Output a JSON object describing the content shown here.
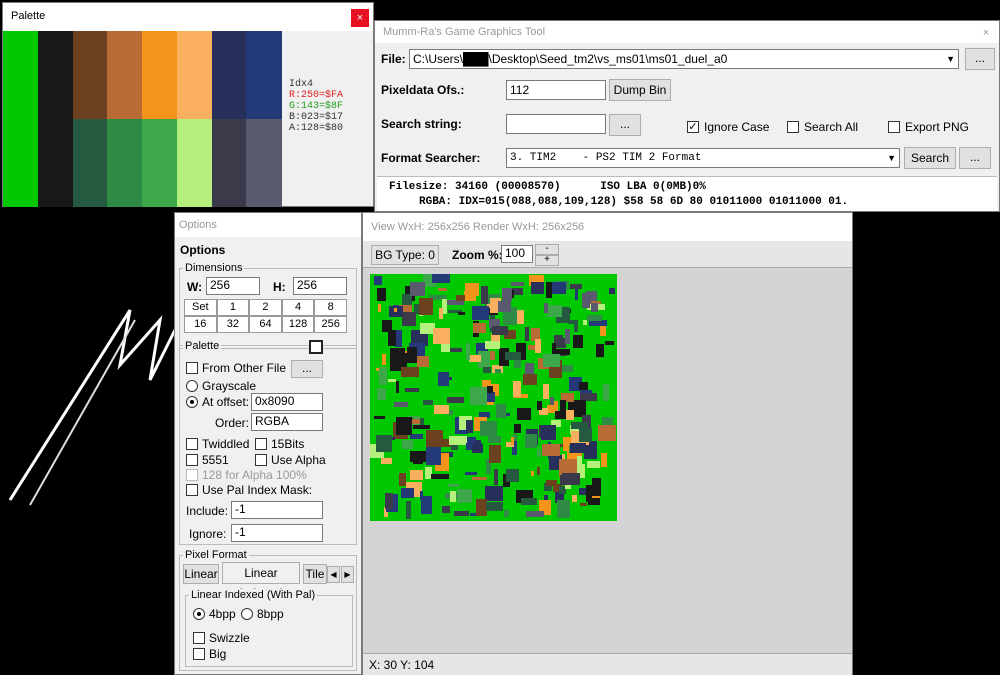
{
  "palette": {
    "title": "Palette",
    "close_label": "×",
    "info": {
      "idx": "Idx4",
      "r": "R:250=$FA",
      "g": "G:143=$8F",
      "b": "B:023=$17",
      "a": "A:128=$80"
    },
    "colors": {
      "row1": [
        "#00c800",
        "#181818",
        "#6b4120",
        "#b86b34",
        "#f5941d",
        "#fbb060",
        "#27305a",
        "#243a78"
      ],
      "row2": [
        "#00c800",
        "#181818",
        "#265a40",
        "#2f8a46",
        "#3da84a",
        "#b6f07c",
        "#3a3a4a",
        "#5a5a6e"
      ]
    }
  },
  "main": {
    "title": "Mumm-Ra's Game Graphics Tool",
    "close_label": "×",
    "file_label": "File:",
    "file_path": "C:\\Users\\███\\Desktop\\Seed_tm2\\vs_ms01\\ms01_duel_a0",
    "browse_label": "...",
    "pixeldata_label": "Pixeldata Ofs.:",
    "pixeldata_value": "112",
    "dump_bin_label": "Dump Bin",
    "search_string_label": "Search string:",
    "search_string_value": "",
    "search_browse_label": "...",
    "ignore_case_label": "Ignore Case",
    "search_all_label": "Search All",
    "export_png_label": "Export PNG",
    "format_searcher_label": "Format Searcher:",
    "format_value": "3. TIM2    - PS2 TIM 2 Format",
    "search_button_label": "Search",
    "format_browse_label": "...",
    "filesize_line": "Filesize: 34160 (00008570)      ISO LBA 0(0MB)0%",
    "rgba_line": "RGBA: IDX=015(088,088,109,128) $58 58 6D 80 01011000 01011000 01."
  },
  "options": {
    "title": "Options",
    "heading": "Options",
    "dimensions_label": "Dimensions",
    "w_label": "W:",
    "w_value": "256",
    "h_label": "H:",
    "h_value": "256",
    "size_row1": [
      "Set",
      "1",
      "2",
      "4",
      "8"
    ],
    "size_row2": [
      "16",
      "32",
      "64",
      "128",
      "256"
    ],
    "palette_group_label": "Palette",
    "from_other_file_label": "From Other File",
    "from_other_browse": "...",
    "grayscale_label": "Grayscale",
    "at_offset_label": "At offset:",
    "at_offset_value": "0x8090",
    "order_label": "Order:",
    "order_value": "RGBA",
    "twiddled_label": "Twiddled",
    "bits15_label": "15Bits",
    "c5551_label": "5551",
    "use_alpha_label": "Use Alpha",
    "alpha128_label": "128 for Alpha 100%",
    "use_pal_mask_label": "Use Pal Index Mask:",
    "include_label": "Include:",
    "include_value": "-1",
    "ignore_label": "Ignore:",
    "ignore_value": "-1",
    "pixel_format_label": "Pixel Format",
    "tab_linear": "Linear",
    "tab_linear_indexed": "Linear Indexed",
    "tab_tile": "Tile",
    "linear_indexed_group": "Linear Indexed (With Pal)",
    "bpp4_label": "4bpp",
    "bpp8_label": "8bpp",
    "swizzle_label": "Swizzle",
    "big_label": "Big"
  },
  "view": {
    "title": "View WxH: 256x256 Render WxH: 256x256",
    "bg_type_label": "BG Type: 0",
    "zoom_label": "Zoom %:",
    "zoom_value": "100",
    "zoom_down": "-",
    "zoom_up": "+",
    "status": "X: 30 Y: 104"
  }
}
